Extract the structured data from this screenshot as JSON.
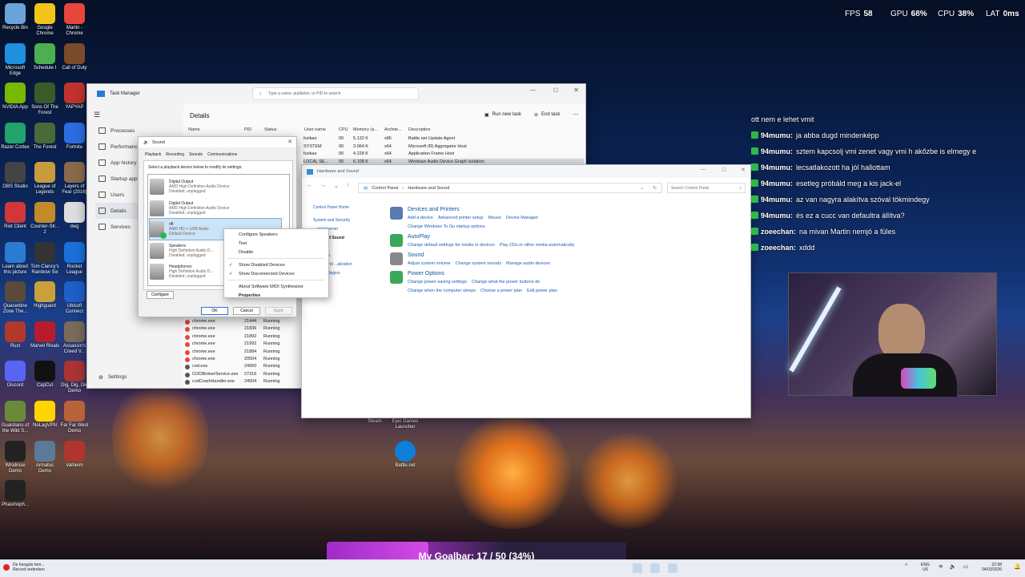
{
  "hud": {
    "fps_label": "FPS",
    "fps": "58",
    "gpu_label": "GPU",
    "gpu": "68",
    "gpu_unit": "%",
    "cpu_label": "CPU",
    "cpu": "38",
    "cpu_unit": "%",
    "lat_label": "LAT",
    "lat": "0",
    "lat_unit": "ms"
  },
  "desktop_icons": [
    "Recycle Bin",
    "Google Chrome",
    "Martin - Chrome",
    "Microsoft Edge",
    "Schedule I",
    "Call of Duty",
    "NVIDIA App",
    "Sons Of The Forest",
    "YAPYAP",
    "Razer Cortex",
    "The Forest",
    "Fortnite",
    "OBS Studio",
    "League of Legends",
    "Layers of Fear (2016)",
    "Riot Client",
    "Counter-Str... 2",
    "dwg",
    "Learn about this picture",
    "Tom Clancy's Rainbow Six",
    "Rocket League",
    "Quarantine Zone The...",
    "Highguard",
    "Ubisoft Connect",
    "Rust",
    "Marvel Rivals",
    "Assassin's Creed V...",
    "Discord",
    "CapCut",
    "Dig, Dig, Die Demo",
    "Guardians of the Wild S...",
    "NoLagVPN",
    "Far Far West Demo",
    "Windrose Demo",
    "Armatus Demo",
    "Valheim",
    "Phasmoph..."
  ],
  "mid_icons": [
    "Steam",
    "Epic Games Launcher",
    "Battle.net"
  ],
  "task_manager": {
    "title": "Task Manager",
    "search_placeholder": "Type a name, publisher, or PID to search",
    "heading": "Details",
    "run_new_task": "Run new task",
    "end_task": "End task",
    "nav": [
      "Processes",
      "Performance",
      "App history",
      "Startup apps",
      "Users",
      "Details",
      "Services"
    ],
    "settings": "Settings",
    "columns": [
      "Name",
      "PID",
      "Status",
      "User name",
      "CPU",
      "Memory (a...",
      "Archite...",
      "Description"
    ],
    "top_rows": [
      [
        "furikao",
        "00",
        "5.132 K",
        "x86",
        "Battle.net Update Agent"
      ],
      [
        "SYSTEM",
        "00",
        "3.064 K",
        "x64",
        "Microsoft (R) Aggregator Host"
      ],
      [
        "furikao",
        "00",
        "4.228 K",
        "x64",
        "Application Frame Host"
      ],
      [
        "LOCAL SE...",
        "00",
        "6.108 K",
        "x64",
        "Windows Audio Device Graph Isolation"
      ]
    ],
    "rows": [
      [
        "chrome.exe",
        "21444",
        "Running"
      ],
      [
        "chrome.exe",
        "21836",
        "Running"
      ],
      [
        "chrome.exe",
        "21892",
        "Running"
      ],
      [
        "chrome.exe",
        "21992",
        "Running"
      ],
      [
        "chrome.exe",
        "21884",
        "Running"
      ],
      [
        "chrome.exe",
        "20504",
        "Running"
      ],
      [
        "cod.exe",
        "24060",
        "Running"
      ],
      [
        "COOBrokerService.exe",
        "27316",
        "Running"
      ],
      [
        "codCrashHandler.exe",
        "24504",
        "Running"
      ]
    ]
  },
  "sound": {
    "title": "Sound",
    "tabs": [
      "Playback",
      "Recording",
      "Sounds",
      "Communications"
    ],
    "instruction": "Select a playback device below to modify its settings:",
    "devices": [
      {
        "name": "Digital Output",
        "desc": "AMD High Definition Audio Device",
        "state": "Disabled, unplugged"
      },
      {
        "name": "Digital Output",
        "desc": "AMD High Definition Audio Device",
        "state": "Disabled, unplugged"
      },
      {
        "name": "rift",
        "desc": "AMD HD + USB Audio",
        "state": "Default Device"
      },
      {
        "name": "Speakers",
        "desc": "High Definition Audio D...",
        "state": "Disabled, unplugged"
      },
      {
        "name": "Headphones",
        "desc": "High Definition Audio D...",
        "state": "Disabled, unplugged"
      }
    ],
    "configure": "Configure",
    "ok": "OK",
    "cancel": "Cancel",
    "apply": "Apply"
  },
  "context_menu": [
    "Configure Speakers",
    "Test",
    "Disable",
    "Show Disabled Devices",
    "Show Disconnected Devices",
    "About Software MIDI Synthesizer",
    "Properties"
  ],
  "control_panel": {
    "title": "Hardware and Sound",
    "crumb1": "Control Panel",
    "crumb2": "Hardware and Sound",
    "search_placeholder": "Search Control Panel",
    "side": [
      "Control Panel Home",
      "System and Security",
      "...and Internet",
      "...are and Sound",
      "...s",
      "...ccounts",
      "...ance and ...alization",
      "...k and Region",
      "...Access"
    ],
    "categories": [
      {
        "title": "Devices and Printers",
        "links": [
          "Add a device",
          "Advanced printer setup",
          "Mouse",
          "Device Manager",
          "Change Windows To Go startup options"
        ]
      },
      {
        "title": "AutoPlay",
        "links": [
          "Change default settings for media or devices",
          "Play CDs or other media automatically"
        ]
      },
      {
        "title": "Sound",
        "links": [
          "Adjust system volume",
          "Change system sounds",
          "Manage audio devices"
        ]
      },
      {
        "title": "Power Options",
        "links": [
          "Change power-saving settings",
          "Change what the power buttons do",
          "Change when the computer sleeps",
          "Choose a power plan",
          "Edit power plan"
        ]
      }
    ]
  },
  "chat": {
    "top": "ott nem e lehet vmit",
    "messages": [
      {
        "user": "94mumu:",
        "text": "ja abba dugd mindenképp"
      },
      {
        "user": "94mumu:",
        "text": "sztem kapcsolj vmi zenet vagy vmi h akőzbe is elmegy e"
      },
      {
        "user": "94mumu:",
        "text": "lecsatlakozott ha jól hallottam"
      },
      {
        "user": "94mumu:",
        "text": "esetleg próbáld meg a kis jack-el"
      },
      {
        "user": "94mumu:",
        "text": "az van nagyra alakítva szóval tökmindegy"
      },
      {
        "user": "94mumu:",
        "text": "és ez a cucc van defaultra állítva?"
      },
      {
        "user": "zoeechan:",
        "text": "na mivan Martin nemjó a füles"
      },
      {
        "user": "zoeechan:",
        "text": "xddd"
      }
    ]
  },
  "goal": {
    "text": "My Goalbar: 17 / 50 (34%)",
    "progress": 0.34
  },
  "taskbar": {
    "notif1": "De hoogste tem...",
    "notif2": "Record verbreken",
    "lang1": "ENG",
    "lang2": "US",
    "time": "22:58",
    "date": "04/03/2026"
  }
}
